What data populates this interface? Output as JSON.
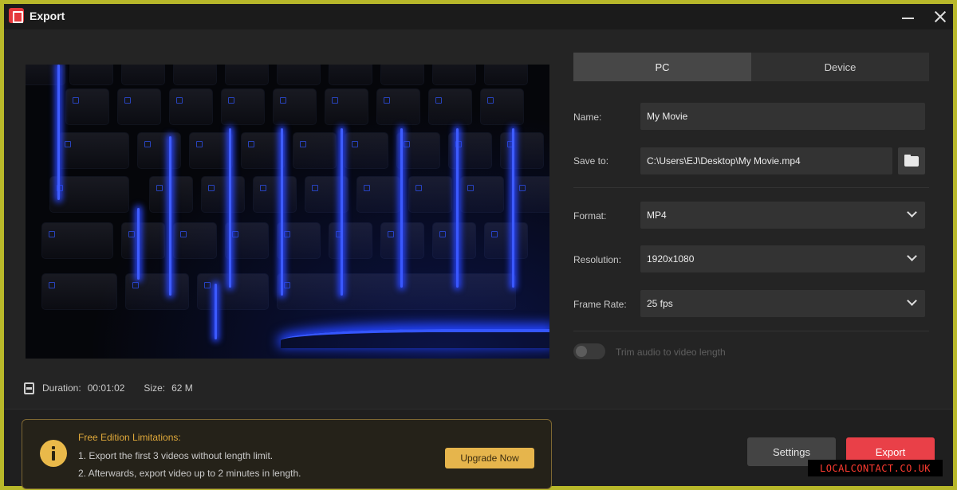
{
  "window": {
    "title": "Export"
  },
  "preview": {
    "image_desc_icon": "keyboard-image"
  },
  "info": {
    "duration_label": "Duration:",
    "duration_value": "00:01:02",
    "size_label": "Size:",
    "size_value": "62 M"
  },
  "tabs": [
    {
      "label": "PC",
      "active": true
    },
    {
      "label": "Device",
      "active": false
    }
  ],
  "form": {
    "name_label": "Name:",
    "name_value": "My Movie",
    "save_label": "Save to:",
    "save_value": "C:\\Users\\EJ\\Desktop\\My Movie.mp4",
    "format_label": "Format:",
    "format_value": "MP4",
    "resolution_label": "Resolution:",
    "resolution_value": "1920x1080",
    "framerate_label": "Frame Rate:",
    "framerate_value": "25 fps",
    "trim_label": "Trim audio to video length"
  },
  "notice": {
    "title": "Free Edition Limitations:",
    "line1": "1. Export the first 3 videos without length limit.",
    "line2": "2. Afterwards, export video up to 2 minutes in length.",
    "upgrade_label": "Upgrade Now"
  },
  "footer": {
    "settings_label": "Settings",
    "export_label": "Export"
  },
  "watermark": "LOCALCONTACT.CO.UK",
  "colors": {
    "accent": "#e94048",
    "upgrade": "#e6b54c",
    "warning_title": "#e0a93a"
  }
}
